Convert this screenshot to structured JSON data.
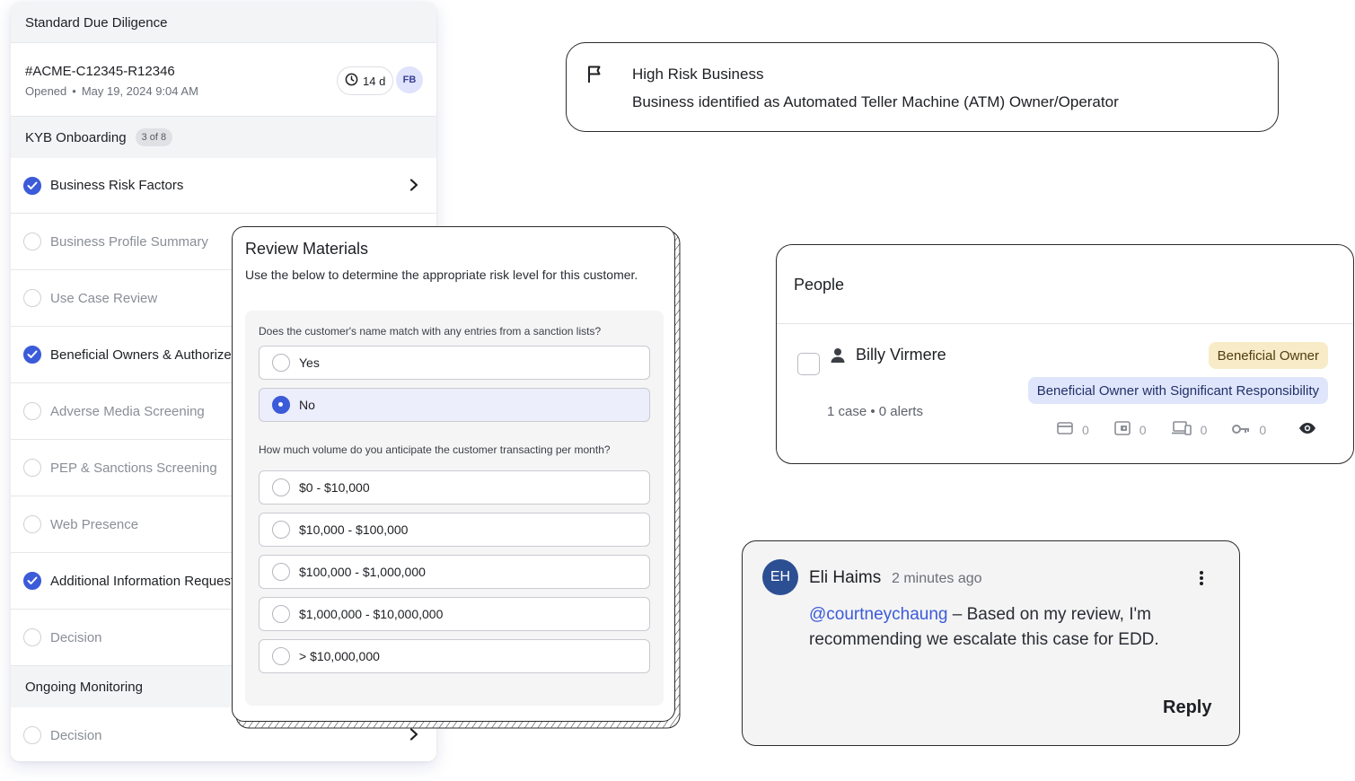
{
  "workflow": {
    "title": "Standard Due Diligence",
    "case_id": "#ACME-C12345-R12346",
    "opened_label": "Opened",
    "opened_sep": "•",
    "opened_date": "May 19, 2024 9:04 AM",
    "timer": "14 d",
    "assignee_initials": "FB",
    "section1": {
      "label": "KYB Onboarding",
      "count": "3 of 8"
    },
    "steps": [
      {
        "label": "Business Risk Factors",
        "done": true
      },
      {
        "label": "Business Profile Summary",
        "done": false
      },
      {
        "label": "Use Case Review",
        "done": false
      },
      {
        "label": "Beneficial Owners & Authorized",
        "done": true
      },
      {
        "label": "Adverse Media Screening",
        "done": false
      },
      {
        "label": "PEP & Sanctions Screening",
        "done": false
      },
      {
        "label": "Web Presence",
        "done": false
      },
      {
        "label": "Additional Information Request",
        "done": true
      },
      {
        "label": "Decision",
        "done": false
      }
    ],
    "section2": {
      "label": "Ongoing Monitoring"
    },
    "steps2": [
      {
        "label": "Decision",
        "done": false
      }
    ]
  },
  "review": {
    "title": "Review Materials",
    "subtitle": "Use the below to determine the appropriate risk level for this customer.",
    "q1": {
      "question": "Does the customer's name match with any entries from a sanction lists?",
      "options": [
        "Yes",
        "No"
      ],
      "selected": "No"
    },
    "q2": {
      "question": "How much volume do you anticipate the customer transacting per month?",
      "options": [
        "$0 - $10,000",
        "$10,000 - $100,000",
        "$100,000 - $1,000,000",
        "$1,000,000 - $10,000,000",
        "> $10,000,000"
      ]
    }
  },
  "risk": {
    "title": "High Risk Business",
    "description": "Business identified as Automated Teller Machine (ATM) Owner/Operator"
  },
  "people": {
    "title": "People",
    "person": {
      "name": "Billy Virmere",
      "tag1": "Beneficial Owner",
      "tag2": "Beneficial Owner with Significant Responsibility",
      "stats": "1 case • 0 alerts",
      "counters": [
        "0",
        "0",
        "0",
        "0"
      ]
    }
  },
  "comment": {
    "avatar_initials": "EH",
    "author": "Eli Haims",
    "time": "2 minutes ago",
    "mention": "@courtneychaung",
    "body": " – Based on my review, I'm recommending we escalate this case for EDD.",
    "reply_label": "Reply"
  },
  "colors": {
    "accent": "#3b5bd9",
    "beneficial_owner_tag": "#f8ebc7",
    "responsibility_tag": "#dfe6fb"
  }
}
